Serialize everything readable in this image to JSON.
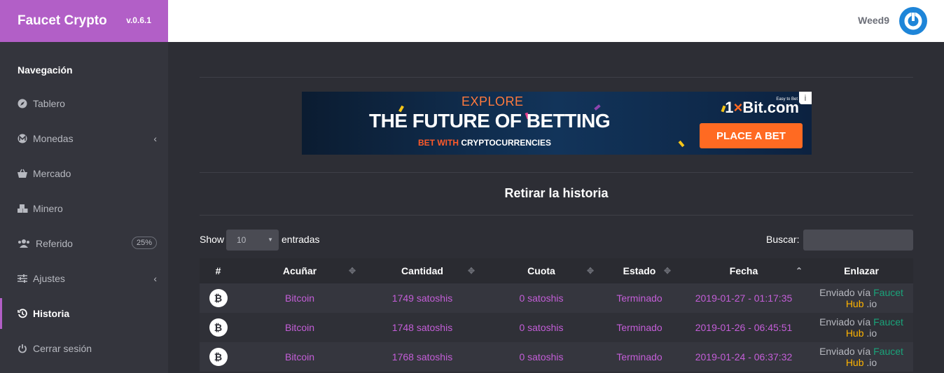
{
  "brand": {
    "name": "Faucet Crypto",
    "version": "v.0.6.1"
  },
  "user": {
    "name": "Weed9"
  },
  "sidebar": {
    "heading": "Navegación",
    "items": [
      {
        "label": "Tablero",
        "icon": "compass-icon"
      },
      {
        "label": "Monedas",
        "icon": "monero-icon"
      },
      {
        "label": "Mercado",
        "icon": "basket-icon"
      },
      {
        "label": "Minero",
        "icon": "cubes-icon"
      },
      {
        "label": "Referido",
        "icon": "users-icon",
        "badge": "25%"
      },
      {
        "label": "Ajustes",
        "icon": "sliders-icon"
      },
      {
        "label": "Historia",
        "icon": "history-icon",
        "active": true
      },
      {
        "label": "Cerrar sesión",
        "icon": "power-icon"
      }
    ]
  },
  "ad": {
    "explore": "EXPLORE",
    "headline": "THE FUTURE OF BETTING",
    "sub_accent": "BET WITH",
    "sub_rest": "CRYPTOCURRENCIES",
    "brand_prefix": "1",
    "brand_x": "×",
    "brand_suffix": "Bit.com",
    "tagline": "Easy to Bet",
    "cta": "PLACE A BET",
    "info": "i"
  },
  "main": {
    "title": "Retirar la historia",
    "show_label": "Show",
    "show_value": "10",
    "entries_label": "entradas",
    "search_label": "Buscar:",
    "search_value": ""
  },
  "table": {
    "columns": [
      "#",
      "Acuñar",
      "Cantidad",
      "Cuota",
      "Estado",
      "Fecha",
      "Enlazar"
    ],
    "rows": [
      {
        "coin": "Bitcoin",
        "amount": "1749 satoshis",
        "fee": "0 satoshis",
        "status": "Terminado",
        "date": "2019-01-27 - 01:17:35",
        "link_prefix": "Enviado vía",
        "link_faucet": "Faucet",
        "link_hub": "Hub",
        "link_io": ".io"
      },
      {
        "coin": "Bitcoin",
        "amount": "1748 satoshis",
        "fee": "0 satoshis",
        "status": "Terminado",
        "date": "2019-01-26 - 06:45:51",
        "link_prefix": "Enviado vía",
        "link_faucet": "Faucet",
        "link_hub": "Hub",
        "link_io": ".io"
      },
      {
        "coin": "Bitcoin",
        "amount": "1768 satoshis",
        "fee": "0 satoshis",
        "status": "Terminado",
        "date": "2019-01-24 - 06:37:32",
        "link_prefix": "Enviado vía",
        "link_faucet": "Faucet",
        "link_hub": "Hub",
        "link_io": ".io"
      }
    ]
  },
  "colors": {
    "accent": "#b25fc7",
    "link": "#c45ed8",
    "avatar": "#1e85d8",
    "ad_cta": "#ff6a22"
  }
}
